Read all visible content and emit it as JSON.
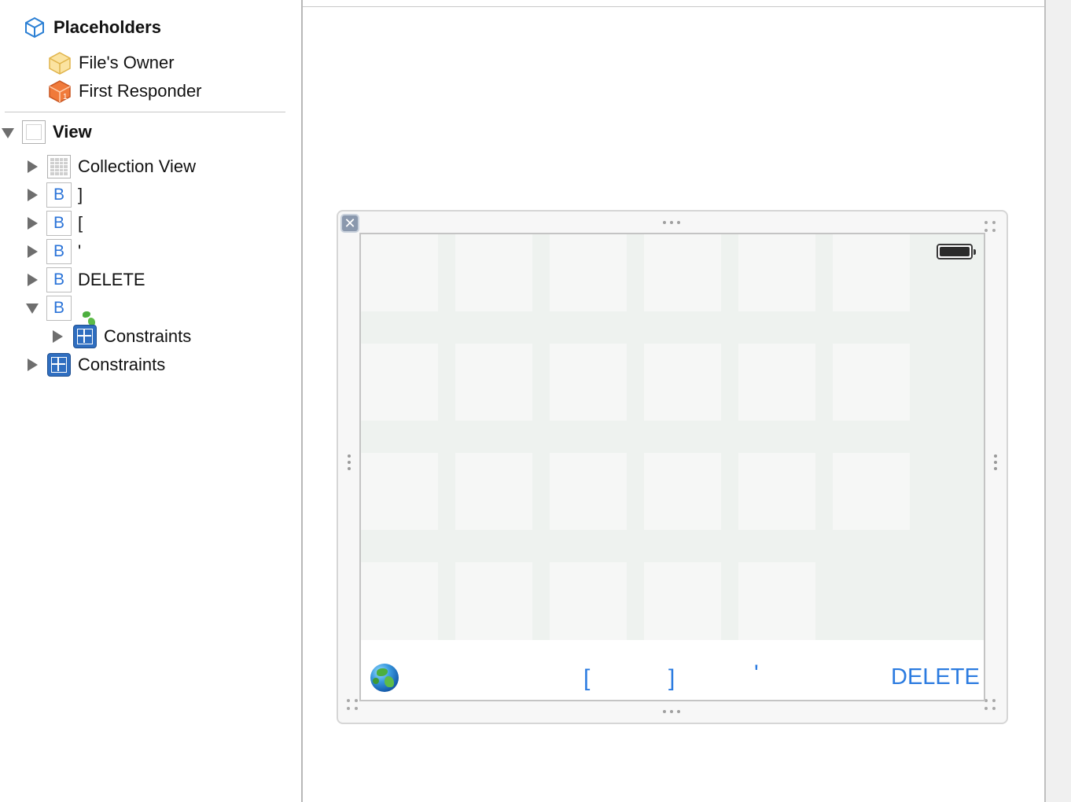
{
  "outline": {
    "placeholders_header": "Placeholders",
    "files_owner": "File's Owner",
    "first_responder": "First Responder",
    "view": "View",
    "items": [
      {
        "label": "Collection View",
        "icon": "collection-view-icon"
      },
      {
        "label": "]",
        "icon": "button-icon",
        "icon_text": "B"
      },
      {
        "label": "[",
        "icon": "button-icon",
        "icon_text": "B"
      },
      {
        "label": "'",
        "icon": "button-icon",
        "icon_text": "B"
      },
      {
        "label": "DELETE",
        "icon": "button-icon",
        "icon_text": "B"
      },
      {
        "label": "",
        "icon": "button-icon",
        "icon_text": "B",
        "emoji": "globe-icon",
        "expanded": true
      },
      {
        "label": "Constraints",
        "icon": "constraints-icon",
        "nested": true
      },
      {
        "label": "Constraints",
        "icon": "constraints-icon"
      }
    ]
  },
  "scene": {
    "buttons": {
      "open_bracket": "[",
      "close_bracket": "]",
      "apostrophe": "'",
      "delete": "DELETE"
    },
    "grid_rows": 4,
    "grid_cols": 6,
    "last_row_cols": 5
  },
  "colors": {
    "accent": "#2b7be0",
    "cell": "#f6f7f6",
    "collection_bg": "#eef2ef",
    "constraints_blue": "#2f6ec0"
  }
}
